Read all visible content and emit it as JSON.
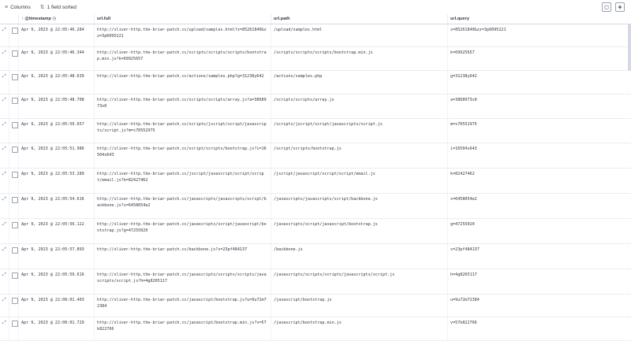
{
  "toolbar": {
    "columns_label": "Columns",
    "sort_label": "1 field sorted",
    "columns_icon": "columns-icon",
    "sort_icon": "sort-icon"
  },
  "headers": {
    "timestamp": "@timestamp",
    "url_full": "url.full",
    "url_path": "url.path",
    "url_query": "url.query"
  },
  "rows": [
    {
      "timestamp": "Apr 9, 2023 @ 22:05:46.284",
      "full": "http://sliver-http.the-briar-patch.cc/upload/samples.html?z=85261840&zz=3p6095221",
      "path": "/upload/samples.html",
      "query": "z=85261840&zz=3p6095221"
    },
    {
      "timestamp": "Apr 9, 2023 @ 22:05:46.344",
      "full": "http://sliver-http.the-briar-patch.cc/scripts/scripts/scripts/bootstrap.min.js?k=69925657",
      "path": "/scripts/scripts/scripts/bootstrap.min.js",
      "query": "k=69925657"
    },
    {
      "timestamp": "Apr 9, 2023 @ 22:05:48.639",
      "full": "http://sliver-http.the-briar-patch.cc/actions/samples.php?g=31238y642",
      "path": "/actions/samples.php",
      "query": "g=31238y642"
    },
    {
      "timestamp": "Apr 9, 2023 @ 22:05:48.708",
      "full": "http://sliver-http.the-briar-patch.cc/scripts/scripts/array.js?a=3868973x0",
      "path": "/scripts/scripts/array.js",
      "query": "a=3868973x0"
    },
    {
      "timestamp": "Apr 9, 2023 @ 22:05:50.657",
      "full": "http://sliver-http.the-briar-patch.cc/scripts/jscript/script/javascripts/script.js?m=s70552975",
      "path": "/scripts/jscript/script/javascripts/script.js",
      "query": "m=s70552975"
    },
    {
      "timestamp": "Apr 9, 2023 @ 22:05:51.986",
      "full": "http://sliver-http.the-briar-patch.cc/script/scripts/bootstrap.js?i=16504s643",
      "path": "/script/scripts/bootstrap.js",
      "query": "i=16504s643"
    },
    {
      "timestamp": "Apr 9, 2023 @ 22:05:53.289",
      "full": "http://sliver-http.the-briar-patch.cc/jscript/javascript/script/script/email.js?k=82427462",
      "path": "/jscript/javascript/script/script/email.js",
      "query": "k=82427462"
    },
    {
      "timestamp": "Apr 9, 2023 @ 22:05:54.616",
      "full": "http://sliver-http.the-briar-patch.cc/javascripts/javascripts/script/backbone.js?s=6458054e2",
      "path": "/javascripts/javascripts/script/backbone.js",
      "query": "s=6458054e2"
    },
    {
      "timestamp": "Apr 9, 2023 @ 22:05:56.122",
      "full": "http://sliver-http.the-briar-patch.cc/javascripts/script/javascript/bootstrap.js?g=47255020",
      "path": "/javascripts/script/javascript/bootstrap.js",
      "query": "g=47255020"
    },
    {
      "timestamp": "Apr 9, 2023 @ 22:05:57.893",
      "full": "http://sliver-http.the-briar-patch.cc/backbone.js?s=23pf484137",
      "path": "/backbone.js",
      "query": "s=23pf484137"
    },
    {
      "timestamp": "Apr 9, 2023 @ 22:05:59.616",
      "full": "http://sliver-http.the-briar-patch.cc/javascripts/scripts/scripts/javascripts/script.js?h=4g8265117",
      "path": "/javascripts/scripts/scripts/javascripts/script.js",
      "query": "h=4g8265117"
    },
    {
      "timestamp": "Apr 9, 2023 @ 22:06:01.403",
      "full": "http://sliver-http.the-briar-patch.cc/javascript/bootstrap.js?u=9u72m72384",
      "path": "/javascript/bootstrap.js",
      "query": "u=9u72m72384"
    },
    {
      "timestamp": "Apr 9, 2023 @ 22:06:01.729",
      "full": "http://sliver-http.the-briar-patch.cc/javascript/bootstrap.min.js?v=57k822766",
      "path": "/javascript/bootstrap.min.js",
      "query": "v=57k822766"
    }
  ]
}
